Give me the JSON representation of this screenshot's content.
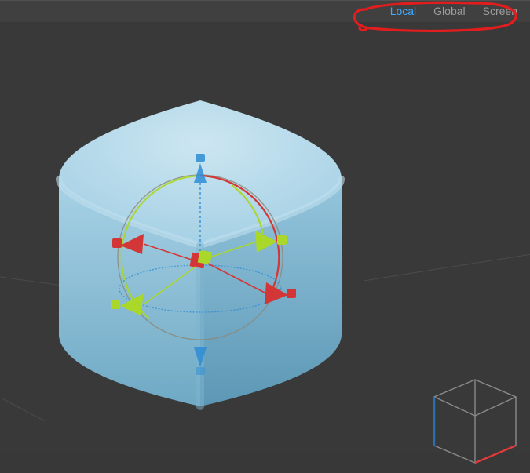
{
  "toolbar": {
    "tabs": [
      {
        "id": "local",
        "label": "Local",
        "active": true
      },
      {
        "id": "global",
        "label": "Global",
        "active": false
      },
      {
        "id": "screen",
        "label": "Screen",
        "active": false
      }
    ]
  },
  "gizmo": {
    "axis_colors": {
      "x": "#e23a3a",
      "y": "#a9d72a",
      "z": "#2e8dd6"
    },
    "mode": "rotate"
  },
  "object": {
    "name": "Cube",
    "color": "#9bc9e0"
  },
  "orientation_cube": {
    "edge_colors": {
      "x": "#e23a3a",
      "y": "#2a6fb0"
    },
    "wire": "#8a8a8a"
  }
}
